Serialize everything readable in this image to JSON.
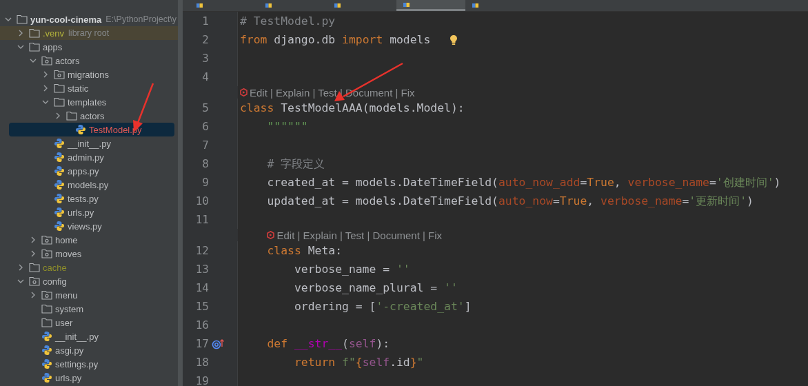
{
  "editor_tabs": [
    {
      "selected": false
    },
    {
      "selected": false
    },
    {
      "selected": false
    },
    {
      "selected": true
    },
    {
      "selected": false
    }
  ],
  "project_tree": [
    {
      "label": "yun-cool-cinema",
      "kind": "folder",
      "expanded": true,
      "selected": false,
      "note": "E:\\PythonProject\\y",
      "children": [
        {
          "label": ".venv",
          "kind": "library",
          "expanded": false,
          "selected": false,
          "color": "#b4b43c",
          "note": "library root"
        },
        {
          "label": "apps",
          "kind": "folder",
          "expanded": true,
          "selected": false,
          "children": [
            {
              "label": "actors",
              "kind": "module",
              "expanded": true,
              "selected": false,
              "children": [
                {
                  "label": "migrations",
                  "kind": "module",
                  "expanded": false,
                  "selected": false
                },
                {
                  "label": "static",
                  "kind": "folder",
                  "expanded": false,
                  "selected": false
                },
                {
                  "label": "templates",
                  "kind": "folder",
                  "expanded": true,
                  "selected": false,
                  "children": [
                    {
                      "label": "actors",
                      "kind": "folder",
                      "expanded": false,
                      "selected": false
                    },
                    {
                      "label": "TestModel.py",
                      "kind": "python",
                      "selected": true,
                      "color": "#e05a55"
                    }
                  ]
                },
                {
                  "label": "__init__.py",
                  "kind": "python",
                  "selected": false
                },
                {
                  "label": "admin.py",
                  "kind": "python",
                  "selected": false
                },
                {
                  "label": "apps.py",
                  "kind": "python",
                  "selected": false
                },
                {
                  "label": "models.py",
                  "kind": "python",
                  "selected": false
                },
                {
                  "label": "tests.py",
                  "kind": "python",
                  "selected": false
                },
                {
                  "label": "urls.py",
                  "kind": "python",
                  "selected": false
                },
                {
                  "label": "views.py",
                  "kind": "python",
                  "selected": false
                }
              ]
            },
            {
              "label": "home",
              "kind": "module",
              "expanded": false,
              "selected": false
            },
            {
              "label": "moves",
              "kind": "module",
              "expanded": false,
              "selected": false
            }
          ]
        },
        {
          "label": "cache",
          "kind": "folder",
          "expanded": false,
          "selected": false,
          "color": "#8f8f2a"
        },
        {
          "label": "config",
          "kind": "module",
          "expanded": true,
          "selected": false,
          "children": [
            {
              "label": "menu",
              "kind": "module",
              "expanded": false,
              "selected": false
            },
            {
              "label": "system",
              "kind": "folder",
              "selected": false
            },
            {
              "label": "user",
              "kind": "folder",
              "selected": false
            },
            {
              "label": "__init__.py",
              "kind": "python",
              "selected": false
            },
            {
              "label": "asgi.py",
              "kind": "python",
              "selected": false
            },
            {
              "label": "settings.py",
              "kind": "python",
              "selected": false
            },
            {
              "label": "urls.py",
              "kind": "python",
              "selected": false
            }
          ]
        }
      ]
    }
  ],
  "code_lines": [
    {
      "kind": "code",
      "n": "1",
      "tokens": [
        {
          "kind": "comment",
          "t": "# TestModel.py"
        }
      ]
    },
    {
      "kind": "code",
      "n": "2",
      "tokens": [
        {
          "kind": "keyword",
          "t": "from"
        },
        {
          "kind": "plain",
          "t": " django.db "
        },
        {
          "kind": "keyword",
          "t": "import"
        },
        {
          "kind": "plain",
          "t": " models"
        },
        {
          "kind": "bulb"
        }
      ]
    },
    {
      "kind": "code",
      "n": "3"
    },
    {
      "kind": "code",
      "n": "4"
    },
    {
      "kind": "hint",
      "text": "Edit | Explain | Test | Document | Fix"
    },
    {
      "kind": "code",
      "n": "5",
      "tokens": [
        {
          "kind": "keyword",
          "t": "class"
        },
        {
          "kind": "plain",
          "t": " TestModelAAA(models.Model):"
        }
      ]
    },
    {
      "kind": "code",
      "n": "6",
      "tokens": [
        {
          "kind": "docstring",
          "t": "    \"\"\"\"\"\""
        }
      ]
    },
    {
      "kind": "code",
      "n": "7"
    },
    {
      "kind": "code",
      "n": "8",
      "tokens": [
        {
          "kind": "comment",
          "t": "    # 字段定义"
        }
      ]
    },
    {
      "kind": "code",
      "n": "9",
      "tokens": [
        {
          "kind": "plain",
          "t": "    created_at = models.DateTimeField("
        },
        {
          "kind": "param",
          "t": "auto_now_add"
        },
        {
          "kind": "plain",
          "t": "="
        },
        {
          "kind": "keyword",
          "t": "True"
        },
        {
          "kind": "plain",
          "t": ", "
        },
        {
          "kind": "param",
          "t": "verbose_name"
        },
        {
          "kind": "plain",
          "t": "="
        },
        {
          "kind": "string",
          "t": "'创建时间'"
        },
        {
          "kind": "plain",
          "t": ")"
        }
      ]
    },
    {
      "kind": "code",
      "n": "10",
      "tokens": [
        {
          "kind": "plain",
          "t": "    updated_at = models.DateTimeField("
        },
        {
          "kind": "param",
          "t": "auto_now"
        },
        {
          "kind": "plain",
          "t": "="
        },
        {
          "kind": "keyword",
          "t": "True"
        },
        {
          "kind": "plain",
          "t": ", "
        },
        {
          "kind": "param",
          "t": "verbose_name"
        },
        {
          "kind": "plain",
          "t": "="
        },
        {
          "kind": "string",
          "t": "'更新时间'"
        },
        {
          "kind": "plain",
          "t": ")"
        }
      ]
    },
    {
      "kind": "code",
      "n": "11"
    },
    {
      "kind": "hint",
      "text": "Edit | Explain | Test | Document | Fix"
    },
    {
      "kind": "code",
      "n": "12",
      "tokens": [
        {
          "kind": "keyword",
          "t": "    class"
        },
        {
          "kind": "plain",
          "t": " Meta:"
        }
      ]
    },
    {
      "kind": "code",
      "n": "13",
      "tokens": [
        {
          "kind": "plain",
          "t": "        verbose_name = "
        },
        {
          "kind": "string",
          "t": "''"
        }
      ]
    },
    {
      "kind": "code",
      "n": "14",
      "tokens": [
        {
          "kind": "plain",
          "t": "        verbose_name_plural = "
        },
        {
          "kind": "string",
          "t": "''"
        }
      ]
    },
    {
      "kind": "code",
      "n": "15",
      "tokens": [
        {
          "kind": "plain",
          "t": "        ordering = ["
        },
        {
          "kind": "string",
          "t": "'-created_at'"
        },
        {
          "kind": "plain",
          "t": "]"
        }
      ]
    },
    {
      "kind": "code",
      "n": "16"
    },
    {
      "kind": "code",
      "n": "17",
      "gutter": {
        "kind": "override"
      },
      "tokens": [
        {
          "kind": "keyword",
          "t": "    def"
        },
        {
          "kind": "magic",
          "t": " __str__"
        },
        {
          "kind": "plain",
          "t": "("
        },
        {
          "kind": "self",
          "t": "self"
        },
        {
          "kind": "plain",
          "t": "):"
        }
      ]
    },
    {
      "kind": "code",
      "n": "18",
      "tokens": [
        {
          "kind": "keyword",
          "t": "        return"
        },
        {
          "kind": "string",
          "t": " f\""
        },
        {
          "kind": "brace",
          "t": "{"
        },
        {
          "kind": "self",
          "t": "self"
        },
        {
          "kind": "plain",
          "t": ".id"
        },
        {
          "kind": "brace",
          "t": "}"
        },
        {
          "kind": "string",
          "t": "\""
        }
      ]
    },
    {
      "kind": "code",
      "n": "19"
    }
  ]
}
